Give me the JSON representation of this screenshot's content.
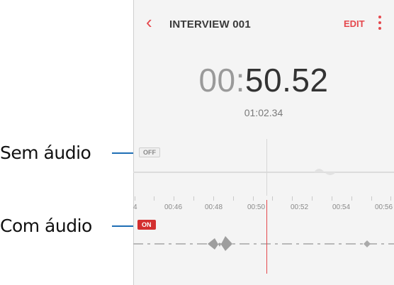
{
  "callouts": {
    "sem_audio": "Sem áudio",
    "com_audio": "Com áudio"
  },
  "appbar": {
    "title": "INTERVIEW 001",
    "edit_label": "EDIT",
    "back_icon": "chevron-left-icon",
    "more_icon": "more-vertical-icon"
  },
  "timer": {
    "minutes": "00:",
    "seconds": "50.52",
    "total": "01:02.34"
  },
  "tracks": {
    "off_label": "OFF",
    "on_label": "ON"
  },
  "timeline": {
    "ticks": [
      "4",
      "00:46",
      "00:48",
      "00:50",
      "00:52",
      "00:54",
      "00:56"
    ]
  },
  "colors": {
    "accent": "#e5484d",
    "on_badge": "#d32f2f",
    "callout_line": "#1f6fb5"
  }
}
